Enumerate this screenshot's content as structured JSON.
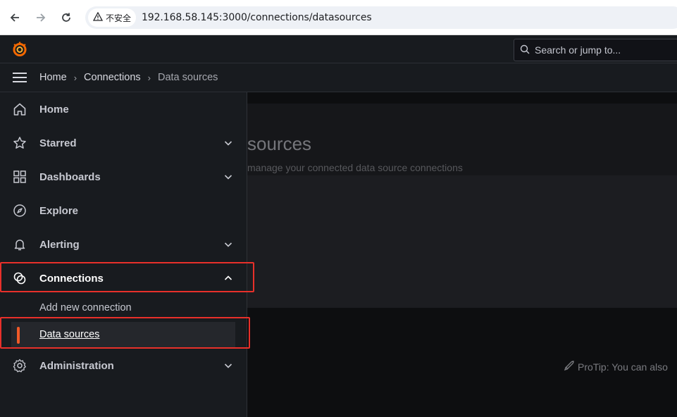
{
  "browser": {
    "security_label": "不安全",
    "url": "192.168.58.145:3000/connections/datasources",
    "back_icon": "back-arrow-icon",
    "forward_icon": "forward-arrow-icon",
    "reload_icon": "reload-icon"
  },
  "topbar": {
    "search_placeholder": "Search or jump to..."
  },
  "breadcrumb": {
    "items": [
      "Home",
      "Connections",
      "Data sources"
    ]
  },
  "sidebar": {
    "items": [
      {
        "label": "Home",
        "icon": "home-icon"
      },
      {
        "label": "Starred",
        "icon": "star-icon"
      },
      {
        "label": "Dashboards",
        "icon": "dashboards-icon"
      },
      {
        "label": "Explore",
        "icon": "compass-icon"
      },
      {
        "label": "Alerting",
        "icon": "bell-icon"
      },
      {
        "label": "Connections",
        "icon": "connections-icon",
        "expanded": true
      },
      {
        "label": "Administration",
        "icon": "gear-icon"
      }
    ],
    "sub_items": [
      {
        "label": "Add new connection"
      },
      {
        "label": "Data sources",
        "selected": true
      }
    ]
  },
  "page": {
    "title": "sources",
    "subtitle": "manage your connected data source connections",
    "protip": "ProTip: You can also"
  },
  "colors": {
    "accent": "#f05a28",
    "highlight": "#e8302a",
    "sidebar_bg": "#181b1f"
  }
}
